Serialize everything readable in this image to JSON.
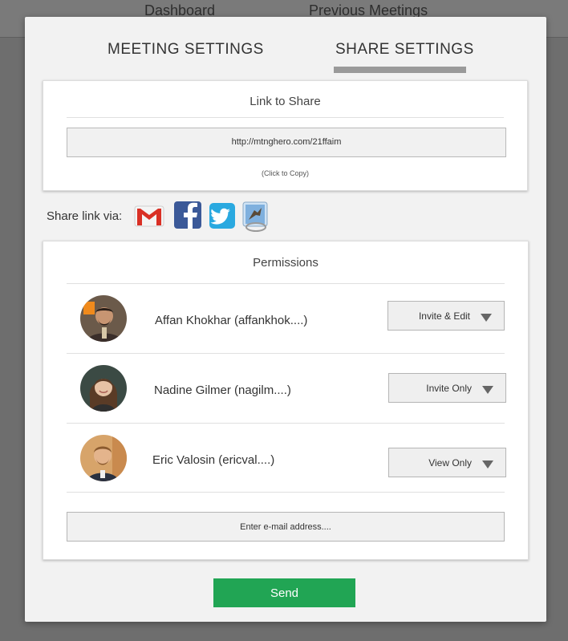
{
  "background_nav": {
    "dashboard_label": "Dashboard",
    "previous_label": "Previous Meetings"
  },
  "tabs": {
    "meeting_settings": "MEETING SETTINGS",
    "share_settings": "SHARE SETTINGS",
    "active": "share_settings"
  },
  "link_card": {
    "title": "Link to Share",
    "url": "http://mtnghero.com/21ffaim",
    "copy_hint": "(Click to Copy)"
  },
  "share_via": {
    "label": "Share link via:",
    "icons": [
      "gmail-icon",
      "facebook-icon",
      "twitter-icon",
      "mail-app-icon"
    ]
  },
  "permissions": {
    "title": "Permissions",
    "people": [
      {
        "name": "Affan Khokhar (affankhok....)",
        "permission": "Invite & Edit"
      },
      {
        "name": "Nadine Gilmer (nagilm....)",
        "permission": "Invite Only"
      },
      {
        "name": "Eric Valosin (ericval....)",
        "permission": "View Only"
      }
    ],
    "email_placeholder": "Enter e-mail address...."
  },
  "send_label": "Send",
  "colors": {
    "send_green": "#21a554",
    "tab_underline": "#9a9a9a",
    "overlay": "#6e6e6e"
  }
}
